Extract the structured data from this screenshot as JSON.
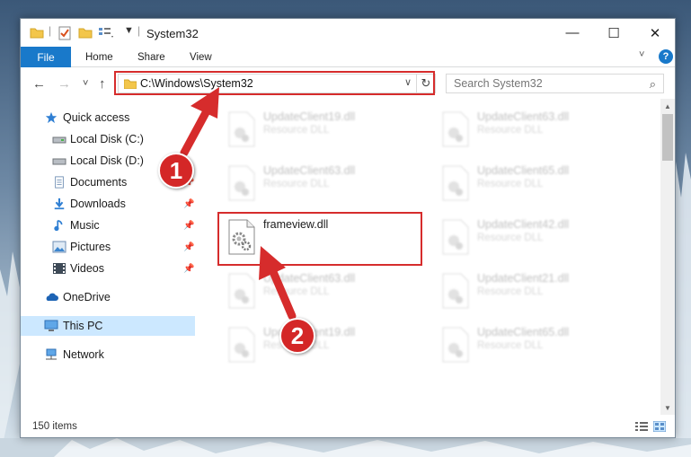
{
  "window": {
    "title": "System32",
    "min_glyph": "—",
    "max_glyph": "☐",
    "close_glyph": "✕"
  },
  "ribbon": {
    "tabs": [
      "File",
      "Home",
      "Share",
      "View"
    ],
    "collapse_glyph": "˅",
    "help_glyph": "?"
  },
  "nav": {
    "back_glyph": "←",
    "forward_glyph": "→",
    "recent_glyph": "˅",
    "up_glyph": "↑",
    "address": "C:\\Windows\\System32",
    "address_drop_glyph": "∨",
    "refresh_glyph": "↻",
    "search_placeholder": "Search System32",
    "search_glyph": "⌕"
  },
  "sidebar": {
    "items": [
      {
        "label": "Quick access",
        "icon": "star-icon",
        "pinned": false
      },
      {
        "label": "Local Disk (C:)",
        "icon": "drive-icon",
        "pinned": false
      },
      {
        "label": "Local Disk (D:)",
        "icon": "drive-icon",
        "pinned": false
      },
      {
        "label": "Documents",
        "icon": "documents-icon",
        "pinned": true
      },
      {
        "label": "Downloads",
        "icon": "download-icon",
        "pinned": true
      },
      {
        "label": "Music",
        "icon": "music-icon",
        "pinned": true
      },
      {
        "label": "Pictures",
        "icon": "pictures-icon",
        "pinned": true
      },
      {
        "label": "Videos",
        "icon": "videos-icon",
        "pinned": true
      },
      {
        "label": "OneDrive",
        "icon": "cloud-icon",
        "pinned": false
      },
      {
        "label": "This PC",
        "icon": "computer-icon",
        "pinned": false,
        "selected": true
      },
      {
        "label": "Network",
        "icon": "network-icon",
        "pinned": false
      }
    ],
    "pin_glyph": "📌"
  },
  "files": [
    {
      "name": "UpdateClient19.dll",
      "type": "Resource DLL"
    },
    {
      "name": "UpdateClient63.dll",
      "type": "Resource DLL"
    },
    {
      "name": "UpdateClient63.dll",
      "type": "Resource DLL"
    },
    {
      "name": "UpdateClient65.dll",
      "type": "Resource DLL"
    },
    {
      "name": "frameview.dll",
      "type": ""
    },
    {
      "name": "UpdateClient42.dll",
      "type": "Resource DLL"
    },
    {
      "name": "UpdateClient63.dll",
      "type": "Resource DLL"
    },
    {
      "name": "UpdateClient21.dll",
      "type": "Resource DLL"
    },
    {
      "name": "UpdateClient19.dll",
      "type": "Resource DLL"
    },
    {
      "name": "UpdateClient65.dll",
      "type": "Resource DLL"
    }
  ],
  "status": {
    "item_count": "150 items"
  },
  "annotations": {
    "step1": "1",
    "step2": "2",
    "color": "#d62c2c"
  }
}
